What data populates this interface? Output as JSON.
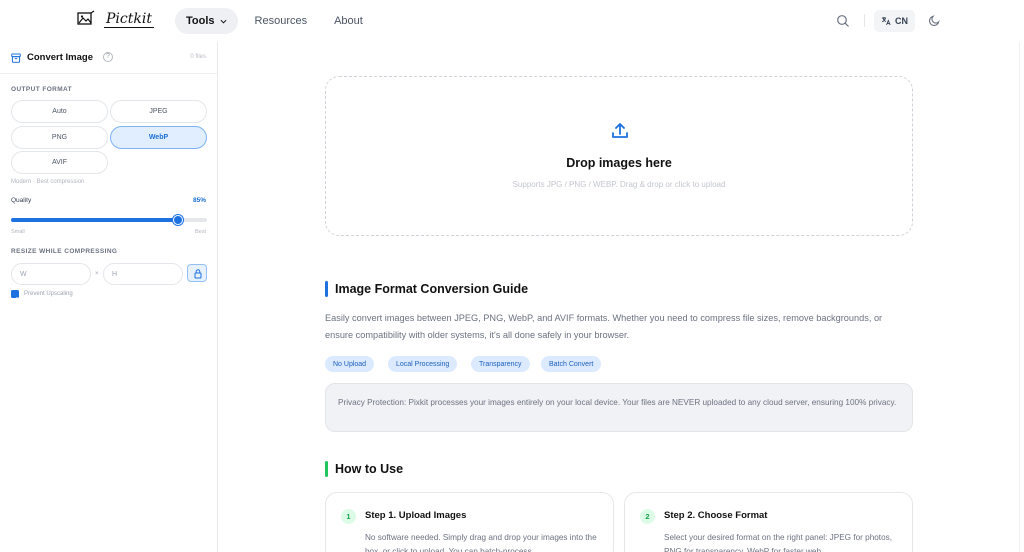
{
  "header": {
    "logo_text": "Pictkit",
    "nav": {
      "tools": "Tools",
      "resources": "Resources",
      "about": "About"
    },
    "lang": "CN"
  },
  "sidebar": {
    "title": "Convert Image",
    "help": "?",
    "files": "0 files",
    "output_format_label": "OUTPUT FORMAT",
    "formats": [
      "Auto",
      "JPEG",
      "PNG",
      "WebP",
      "AVIF"
    ],
    "selected_format": "WebP",
    "format_hint": "Modern · Best compression",
    "quality_label": "Quality",
    "quality_value": "85%",
    "quality_fraction": 0.85,
    "slider_min_label": "Small",
    "slider_max_label": "Best",
    "resize_label": "RESIZE WHILE COMPRESSING",
    "width_placeholder": "W",
    "height_placeholder": "H",
    "dim_separator": "×",
    "prevent_upscaling": "Prevent Upscaling",
    "prevent_upscaling_checked": true
  },
  "dropzone": {
    "title": "Drop images here",
    "subtitle": "Supports JPG / PNG / WEBP. Drag & drop or click to upload"
  },
  "guide": {
    "title": "Image Format Conversion Guide",
    "paragraph": "Easily convert images between JPEG, PNG, WebP, and AVIF formats. Whether you need to compress file sizes, remove backgrounds, or ensure compatibility with older systems, it's all done safely in your browser.",
    "tags": [
      "No Upload",
      "Local Processing",
      "Transparency",
      "Batch Convert"
    ],
    "privacy": "Privacy Protection: Pixkit processes your images entirely on your local device. Your files are NEVER uploaded to any cloud server, ensuring 100% privacy."
  },
  "howto": {
    "title": "How to Use",
    "steps": [
      {
        "num": "1",
        "title": "Step 1. Upload Images",
        "desc": "No software needed. Simply drag and drop your images into the box, or click to upload. You can batch-process"
      },
      {
        "num": "2",
        "title": "Step 2. Choose Format",
        "desc": "Select your desired format on the right panel: JPEG for photos, PNG for transparency, WebP for faster web"
      }
    ]
  },
  "colors": {
    "accent": "#1d72e0",
    "guide_bar": "#1d72e0",
    "howto_bar": "#22c55e"
  }
}
